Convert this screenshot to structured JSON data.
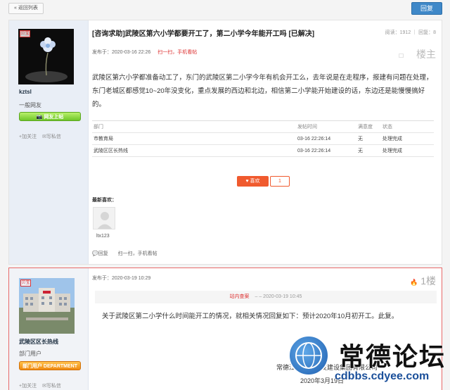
{
  "topbar": {
    "back_label": "« 返回列表",
    "reply_label": "回复"
  },
  "post1": {
    "title": "[咨询求助]武陵区第六小学都要开工了，第二小学今年能开工吗 [已解决]",
    "stats": "阅读：1912 ｜ 回复：8",
    "posted_at": "发布于：2020-03-16 22:26",
    "mobile_label": "扫一扫，手机看帖",
    "floor_label": "楼主",
    "floor_tools": "☐",
    "body": "武陵区第六小学都准备动工了，东门的武陵区第二小学今年有机会开工么，去年说是在走程序，报建有问题在处理，东门老城区都感觉10~20年没变化，重点发展的西边和北边，相信第二小学能开始建设的话，东边还是能慢慢搞好的。",
    "author": {
      "name": "kztsl",
      "rank": "一般网友",
      "badge": "📷 网友上帖",
      "vip": "贝宝",
      "follow": "+加关注",
      "message": "✉写私信"
    },
    "table": {
      "headers": [
        "部门",
        "发帖时间",
        "满意度",
        "状态"
      ],
      "rows": [
        [
          "市教育局",
          "03-16 22:26:14",
          "无",
          "处理完成"
        ],
        [
          "武陵区区长热线",
          "03-16 22:26:14",
          "无",
          "处理完成"
        ]
      ]
    },
    "like_label": "♥ 喜欢",
    "like_count": "1",
    "recent_label": "最新喜欢：",
    "recent_user": "ltx123",
    "reply_link": "💬回复",
    "mobile_link": "扫一扫，手机看帖"
  },
  "post2": {
    "posted_at": "发布于：2020-03-19 10:29",
    "floor_label": "1楼",
    "floor_icon": "🔥",
    "quote_who": "站内查案",
    "quote_text": "–  – 2020-03-19 10:45",
    "reply_text": "关于武陵区第二小学什么时间能开工的情况，就相关情况回复如下：预计2020年10月初开工。此复。",
    "sign_org": "常德江北城区开发建设集团有限公司",
    "sign_date": "2020年3月19日",
    "author": {
      "name": "武陵区区长热线",
      "rank": "部门用户",
      "badge": "部门用户 DEPARTMENT",
      "vip": "贝宝",
      "follow": "+加关注",
      "message": "✉写私信"
    }
  },
  "watermark": {
    "title": "常德论坛",
    "url": "cdbbs.cdyee.com"
  },
  "colors": {
    "accent_blue": "#3f88c8",
    "like_orange": "#f05a2e",
    "highlight_red": "#e86a6a"
  }
}
